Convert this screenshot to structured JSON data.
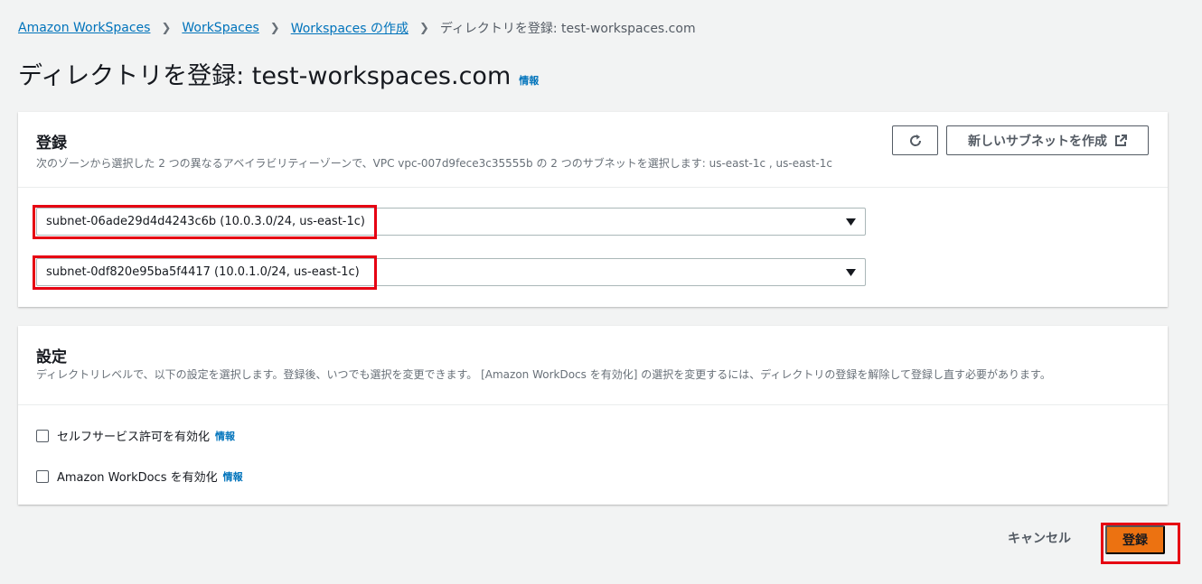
{
  "breadcrumb": {
    "items": [
      "Amazon WorkSpaces",
      "WorkSpaces",
      "Workspaces の作成"
    ],
    "current": "ディレクトリを登録: test-workspaces.com"
  },
  "page": {
    "title": "ディレクトリを登録: test-workspaces.com",
    "info": "情報"
  },
  "register": {
    "title": "登録",
    "description": "次のゾーンから選択した 2 つの異なるアベイラビリティーゾーンで、VPC vpc-007d9fece3c35555b の 2 つのサブネットを選択します: us-east-1c , us-east-1c",
    "new_subnet_label": "新しいサブネットを作成",
    "subnets": [
      "subnet-06ade29d4d4243c6b (10.0.3.0/24, us-east-1c)",
      "subnet-0df820e95ba5f4417 (10.0.1.0/24, us-east-1c)"
    ]
  },
  "settings": {
    "title": "設定",
    "description": "ディレクトリレベルで、以下の設定を選択します。登録後、いつでも選択を変更できます。 [Amazon WorkDocs を有効化] の選択を変更するには、ディレクトリの登録を解除して登録し直す必要があります。",
    "selfservice_label": "セルフサービス許可を有効化",
    "workdocs_label": "Amazon WorkDocs を有効化",
    "info": "情報"
  },
  "footer": {
    "cancel_label": "キャンセル",
    "register_label": "登録"
  },
  "colors": {
    "primary": "#ec7211",
    "link": "#0073bb",
    "highlight": "#e60012"
  }
}
